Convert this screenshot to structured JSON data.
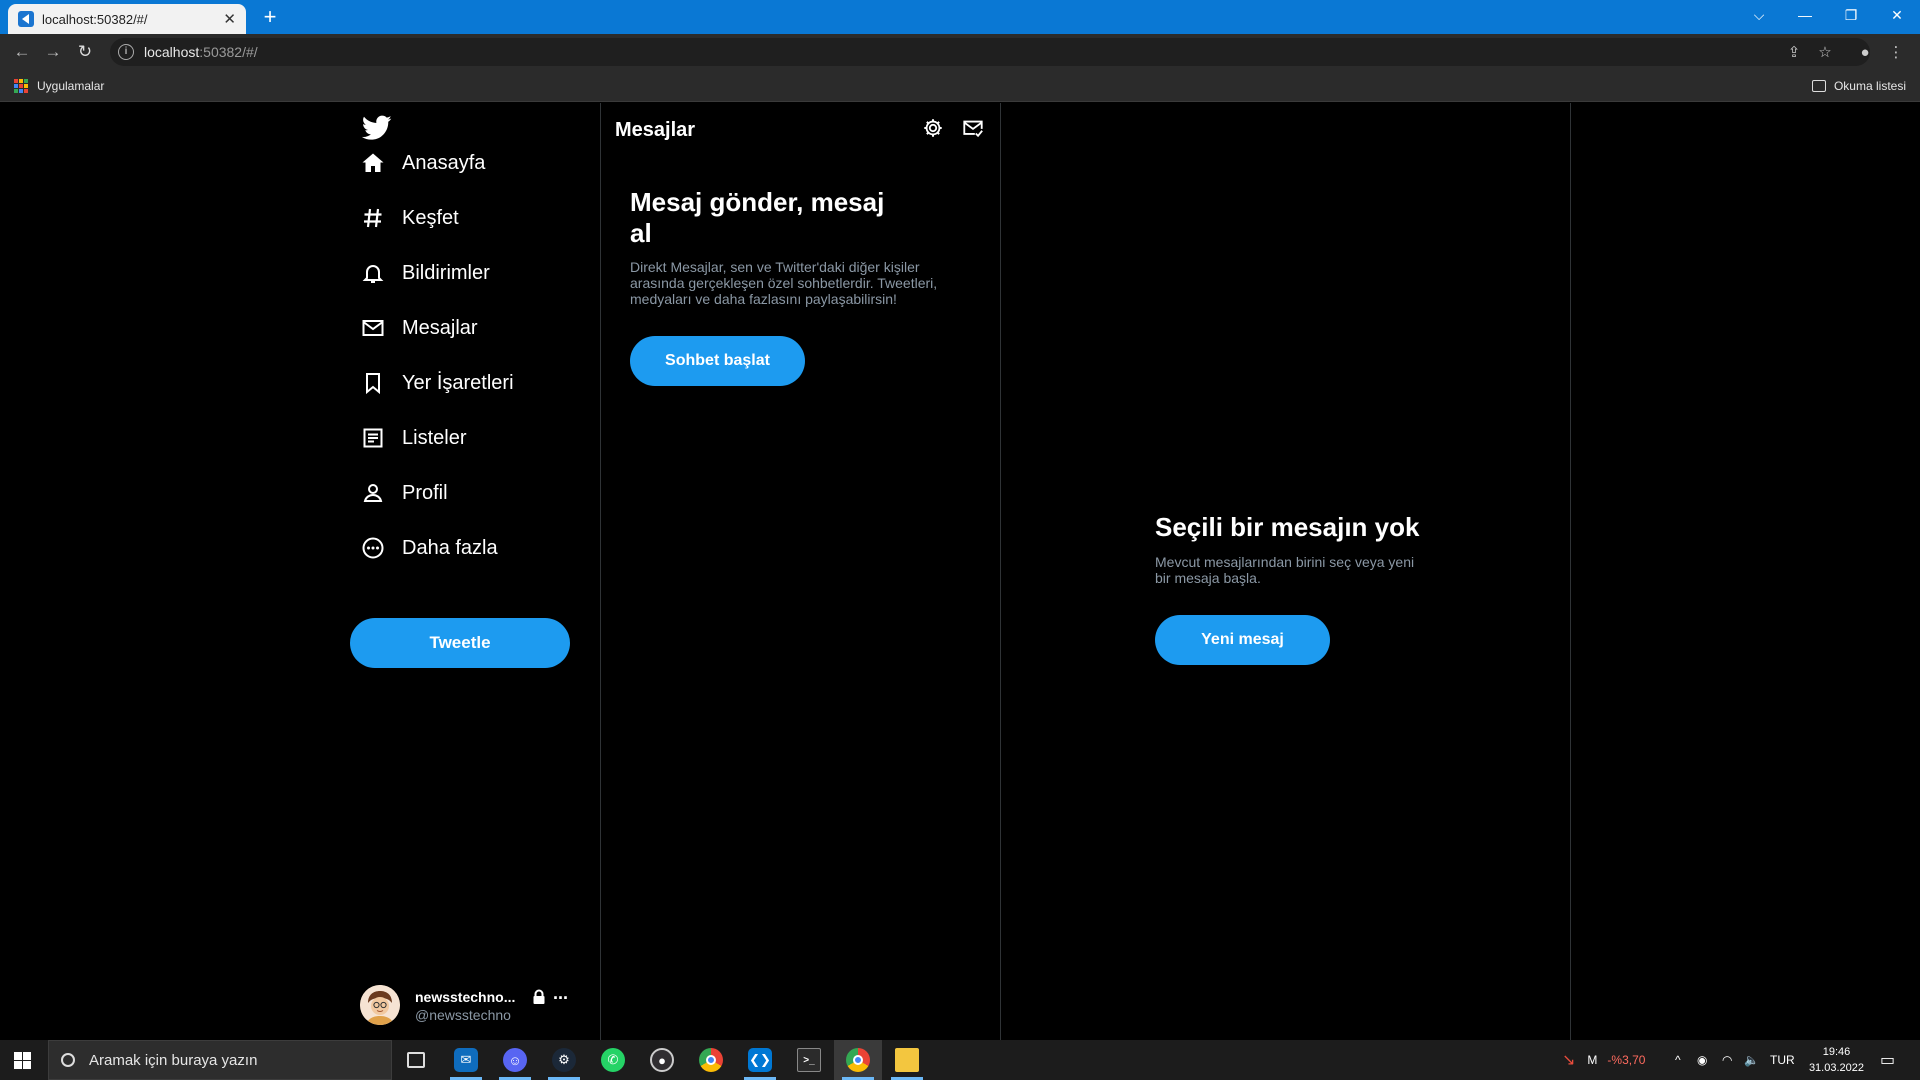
{
  "browser": {
    "tab_title": "localhost:50382/#/",
    "tab_close": "✕",
    "new_tab": "+",
    "url_host": "localhost",
    "url_rest": ":50382/#/",
    "bookmark_apps": "Uygulamalar",
    "reading_list": "Okuma listesi"
  },
  "nav": {
    "items": [
      {
        "label": "Anasayfa",
        "icon": "home-icon"
      },
      {
        "label": "Keşfet",
        "icon": "hashtag-icon"
      },
      {
        "label": "Bildirimler",
        "icon": "bell-icon"
      },
      {
        "label": "Mesajlar",
        "icon": "mail-icon"
      },
      {
        "label": "Yer İşaretleri",
        "icon": "bookmark-icon"
      },
      {
        "label": "Listeler",
        "icon": "list-icon"
      },
      {
        "label": "Profil",
        "icon": "person-icon"
      },
      {
        "label": "Daha fazla",
        "icon": "more-circle-icon"
      }
    ],
    "tweet_button": "Tweetle",
    "account": {
      "name": "newsstechno...",
      "handle": "@newsstechno",
      "more": "..."
    }
  },
  "messages": {
    "title": "Mesajlar",
    "heading": "Mesaj gönder, mesaj al",
    "description": "Direkt Mesajlar, sen ve Twitter'daki diğer kişiler arasında gerçekleşen özel sohbetlerdir. Tweetleri, medyaları ve daha fazlasını paylaşabilirsin!",
    "start_button": "Sohbet başlat"
  },
  "detail": {
    "title": "Seçili bir mesajın yok",
    "description": "Mevcut mesajlarından birini seç veya yeni bir mesaja başla.",
    "new_message_button": "Yeni mesaj"
  },
  "taskbar": {
    "search_placeholder": "Aramak için buraya yazın",
    "stock_label": "M",
    "stock_change": "-%3,70",
    "language": "TUR",
    "time": "19:46",
    "date": "31.03.2022"
  },
  "colors": {
    "accent": "#1d9bf0",
    "background": "#000000",
    "secondary_text": "#8b98a5",
    "titlebar": "#0a78d4"
  }
}
